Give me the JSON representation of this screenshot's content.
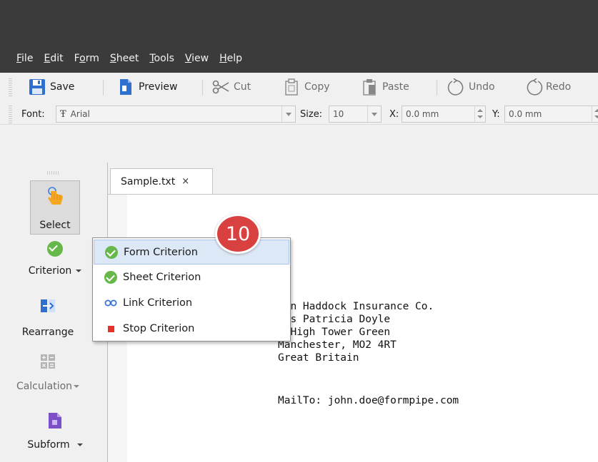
{
  "menu": {
    "items": [
      {
        "prefix": "",
        "key": "F",
        "suffix": "ile"
      },
      {
        "prefix": "",
        "key": "E",
        "suffix": "dit"
      },
      {
        "prefix": "F",
        "key": "o",
        "suffix": "rm"
      },
      {
        "prefix": "",
        "key": "S",
        "suffix": "heet"
      },
      {
        "prefix": "",
        "key": "T",
        "suffix": "ools"
      },
      {
        "prefix": "",
        "key": "V",
        "suffix": "iew"
      },
      {
        "prefix": "",
        "key": "H",
        "suffix": "elp"
      }
    ]
  },
  "toolbar": {
    "save": "Save",
    "preview": "Preview",
    "cut": "Cut",
    "copy": "Copy",
    "paste": "Paste",
    "undo": "Undo",
    "redo": "Redo"
  },
  "format_bar": {
    "font_label": "Font:",
    "font_value": "Arial",
    "size_label": "Size:",
    "size_value": "10",
    "x_label": "X:",
    "x_value": "0.0 mm",
    "y_label": "Y:",
    "y_value": "0.0 mm"
  },
  "side": {
    "select": "Select",
    "criterion": "Criterion",
    "rearrange": "Rearrange",
    "calculation": "Calculation",
    "subform": "Subform"
  },
  "tab": {
    "label": "Sample.txt",
    "close": "×"
  },
  "document": {
    "lines": [
      "ohn Haddock Insurance Co.",
      "iss Patricia Doyle",
      "0 High Tower Green",
      "Manchester, MO2 4RT",
      "Great Britain"
    ],
    "mail": "MailTo: john.doe@formpipe.com"
  },
  "popup": {
    "items": [
      {
        "label": "Form Criterion",
        "icon": "green-check-icon"
      },
      {
        "label": "Sheet Criterion",
        "icon": "green-check-icon"
      },
      {
        "label": "Link Criterion",
        "icon": "link-icon"
      },
      {
        "label": "Stop Criterion",
        "icon": "red-stop-icon"
      }
    ]
  },
  "step_badge": "10",
  "colors": {
    "titlebar": "#3b3b3b",
    "accent_blue": "#2f6fd0",
    "check_green": "#67b84a",
    "stop_red": "#e8312a",
    "badge_red": "#d8413f",
    "highlight": "#dde8f6"
  }
}
